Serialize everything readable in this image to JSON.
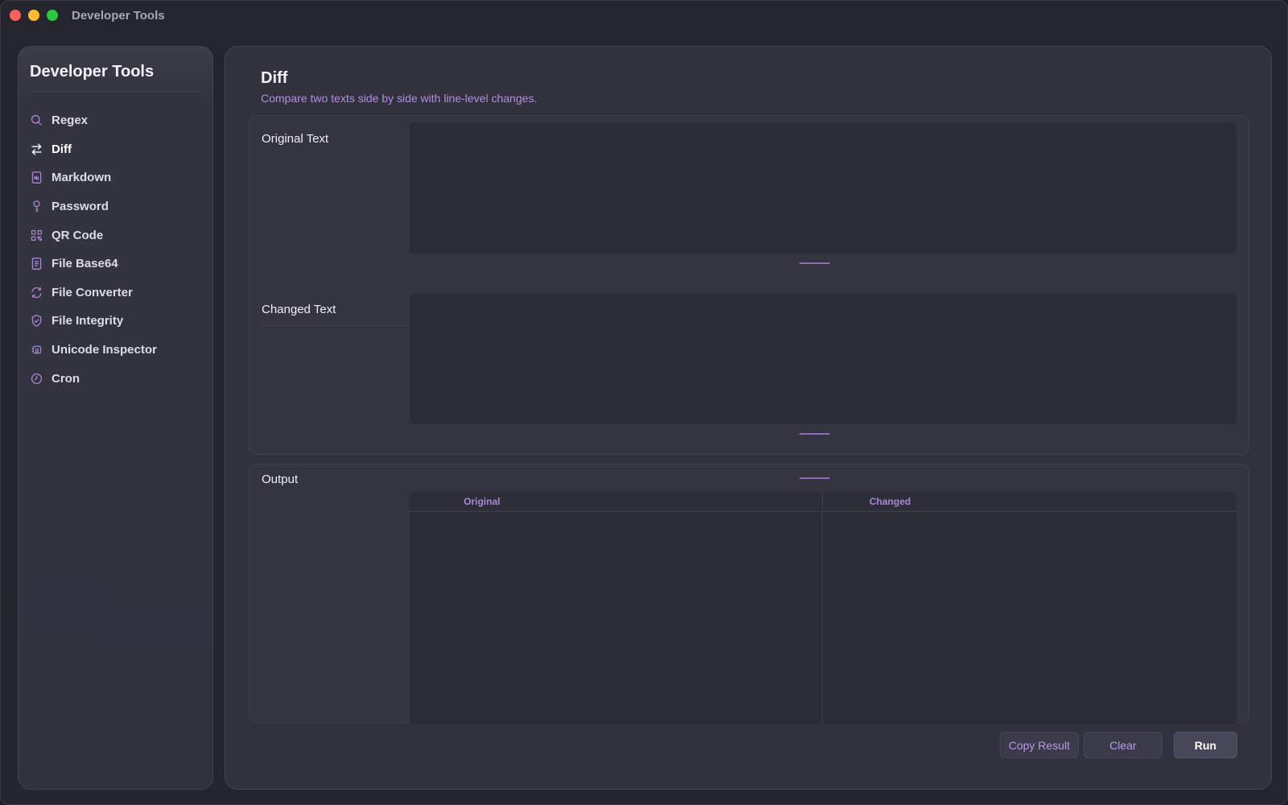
{
  "window": {
    "title": "Developer Tools"
  },
  "sidebar": {
    "title": "Developer Tools",
    "items": [
      {
        "label": "Regex",
        "icon": "search-icon"
      },
      {
        "label": "Diff",
        "icon": "arrows-swap-icon",
        "active": true
      },
      {
        "label": "Markdown",
        "icon": "markdown-file-icon"
      },
      {
        "label": "Password",
        "icon": "key-icon"
      },
      {
        "label": "QR Code",
        "icon": "qr-code-icon"
      },
      {
        "label": "File Base64",
        "icon": "document-icon"
      },
      {
        "label": "File Converter",
        "icon": "refresh-icon"
      },
      {
        "label": "File Integrity",
        "icon": "shield-check-icon"
      },
      {
        "label": "Unicode Inspector",
        "icon": "unicode-icon"
      },
      {
        "label": "Cron",
        "icon": "clock-icon"
      }
    ]
  },
  "main": {
    "title": "Diff",
    "subtitle": "Compare two texts side by side with line-level changes.",
    "original_label": "Original Text",
    "original_value": "",
    "changed_label": "Changed Text",
    "changed_value": "",
    "output_label": "Output",
    "diff_columns": {
      "original": "Original",
      "changed": "Changed"
    }
  },
  "buttons": {
    "copy": "Copy Result",
    "clear": "Clear",
    "run": "Run"
  },
  "colors": {
    "accent": "#b38ee0",
    "background": "#25252f",
    "panel": "#32323e"
  }
}
